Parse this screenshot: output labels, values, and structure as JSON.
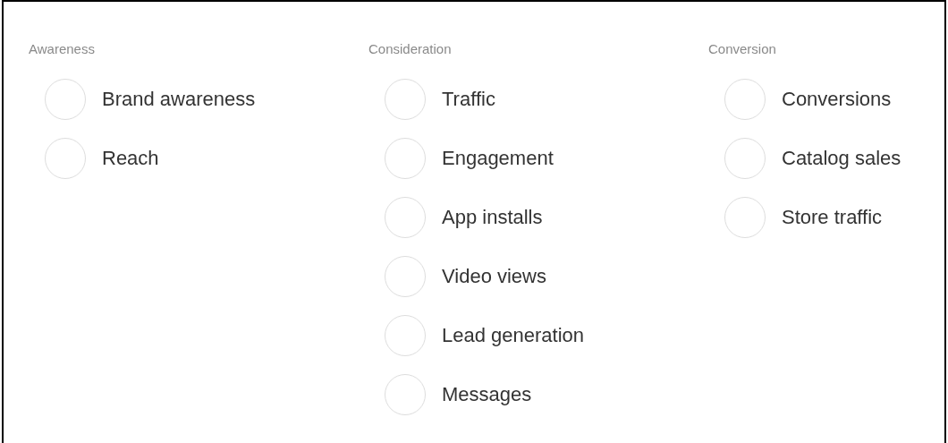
{
  "groups": [
    {
      "title": "Awareness",
      "options": [
        {
          "label": "Brand awareness",
          "selected": false
        },
        {
          "label": "Reach",
          "selected": false
        }
      ]
    },
    {
      "title": "Consideration",
      "options": [
        {
          "label": "Traffic",
          "selected": false
        },
        {
          "label": "Engagement",
          "selected": false
        },
        {
          "label": "App installs",
          "selected": false
        },
        {
          "label": "Video views",
          "selected": false
        },
        {
          "label": "Lead generation",
          "selected": false
        },
        {
          "label": "Messages",
          "selected": false
        }
      ]
    },
    {
      "title": "Conversion",
      "options": [
        {
          "label": "Conversions",
          "selected": false
        },
        {
          "label": "Catalog sales",
          "selected": false
        },
        {
          "label": "Store traffic",
          "selected": false
        }
      ]
    }
  ]
}
